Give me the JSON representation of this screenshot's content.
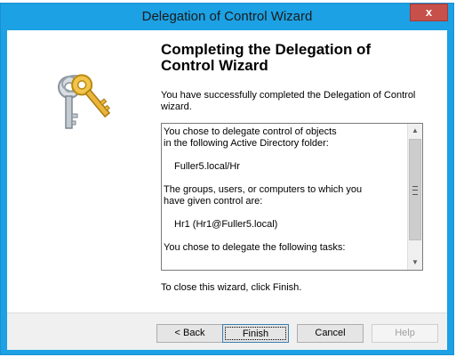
{
  "window": {
    "title": "Delegation of Control Wizard",
    "close_label": "x",
    "accent_color": "#1ca1e4"
  },
  "left_panel": {
    "graphic": "keys-icon"
  },
  "main": {
    "heading": "Completing the Delegation of Control Wizard",
    "description": "You have successfully completed the Delegation of Control wizard.",
    "summary_lines": [
      "You chose to delegate control of objects",
      "in the following Active Directory folder:",
      "Fuller5.local/Hr",
      "The groups, users, or computers to which you",
      "have given control are:",
      "Hr1 (Hr1@Fuller5.local)",
      "You chose to delegate the following tasks:"
    ],
    "scroll_up_glyph": "▲",
    "scroll_down_glyph": "▼",
    "finish_note": "To close this wizard, click Finish."
  },
  "buttons": {
    "back": "< Back",
    "finish": "Finish",
    "cancel": "Cancel",
    "help": "Help"
  }
}
